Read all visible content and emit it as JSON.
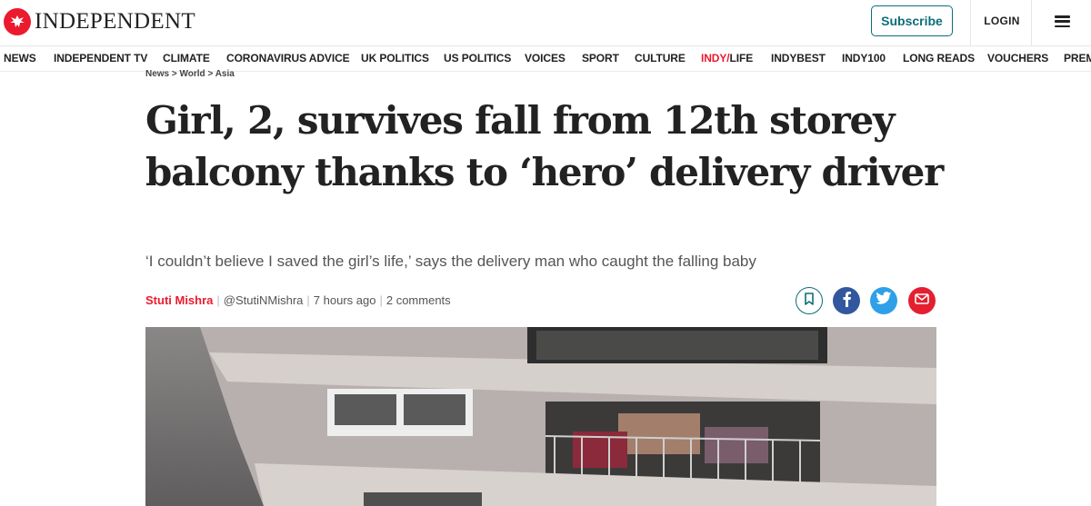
{
  "header": {
    "logo_text": "INDEPENDENT",
    "subscribe_label": "Subscribe",
    "login_label": "LOGIN"
  },
  "nav": {
    "items": [
      {
        "label": "NEWS"
      },
      {
        "label": "INDEPENDENT TV"
      },
      {
        "label": "CLIMATE"
      },
      {
        "label": "CORONAVIRUS ADVICE"
      },
      {
        "label": "UK POLITICS"
      },
      {
        "label": "US POLITICS"
      },
      {
        "label": "VOICES"
      },
      {
        "label": "SPORT"
      },
      {
        "label": "CULTURE"
      },
      {
        "label_red": "INDY/",
        "label_rest": "LIFE"
      },
      {
        "label": "INDYBEST"
      },
      {
        "label": "INDY100"
      },
      {
        "label": "LONG READS"
      },
      {
        "label": "VOUCHERS"
      },
      {
        "label": "PREM"
      }
    ]
  },
  "article": {
    "breadcrumb": "News > World > Asia",
    "headline": "Girl, 2, survives fall from 12th storey balcony thanks to ‘hero’ delivery driver",
    "standfirst": "‘I couldn’t believe I saved the girl’s life,’ says the delivery man who caught the falling baby",
    "author": "Stuti Mishra",
    "handle": "@StutiNMishra",
    "time": "7 hours ago",
    "comments": "2 comments"
  },
  "colors": {
    "brand_red": "#ec1a2e",
    "teal": "#0c6e79",
    "facebook": "#33579f",
    "twitter": "#2f9fe8",
    "email": "#e41f2f"
  },
  "icons": {
    "logo": "eagle-logo-icon",
    "menu": "hamburger-menu-icon",
    "bookmark": "bookmark-icon",
    "facebook": "facebook-icon",
    "twitter": "twitter-icon",
    "email": "email-icon"
  }
}
